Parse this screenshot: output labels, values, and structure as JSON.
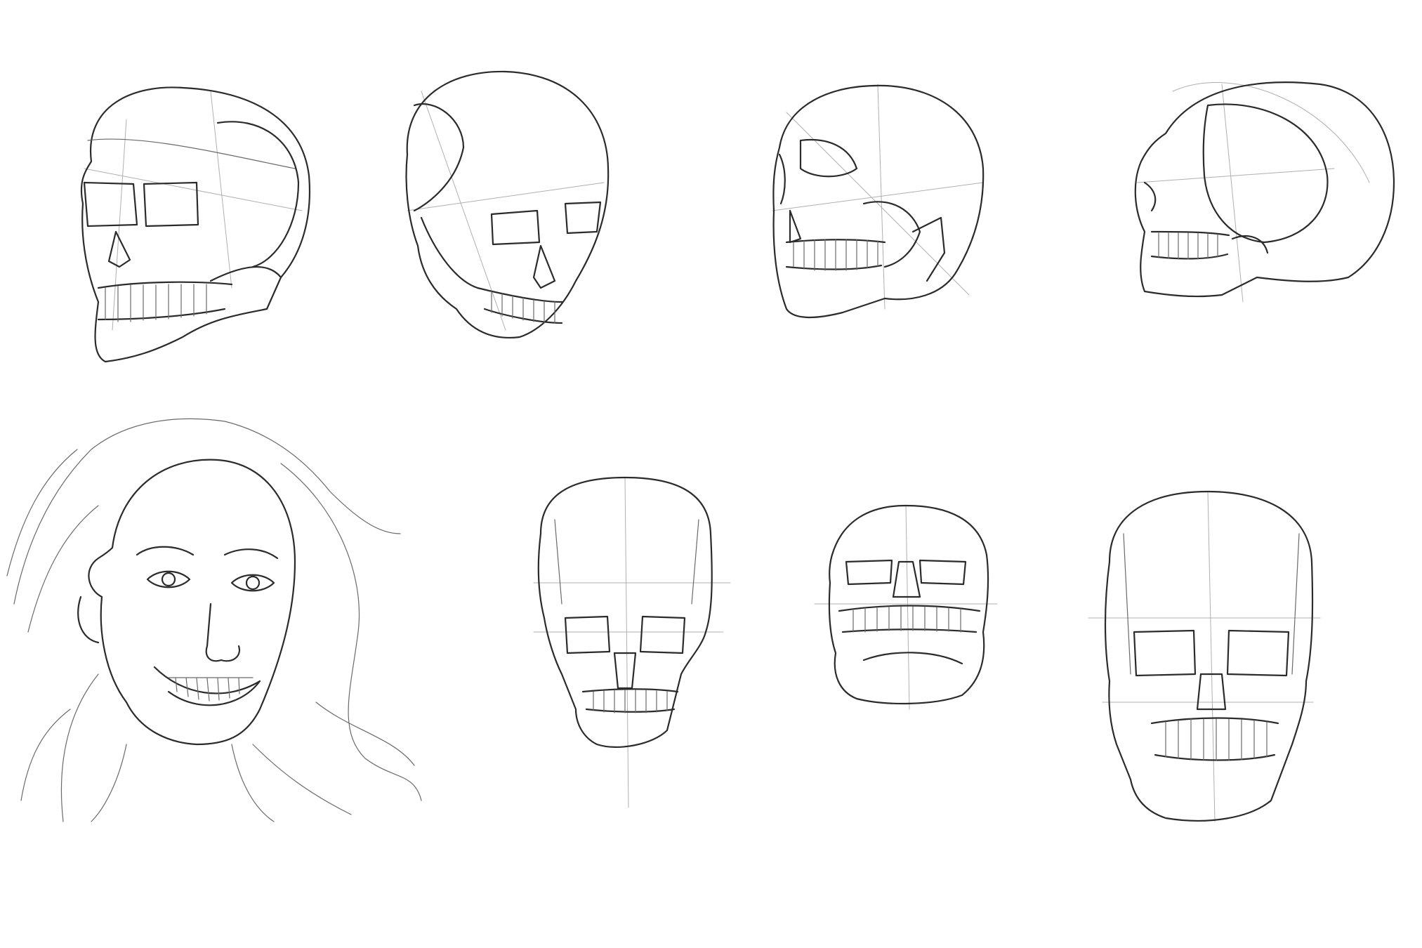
{
  "canvas": {
    "background": "#ffffff",
    "stroke_dark": "#2b2b2b",
    "stroke_mid": "#6a6a6a",
    "stroke_light": "#b0b0b0"
  },
  "drawings": [
    {
      "id": "skull-three-quarter-left"
    },
    {
      "id": "skull-tilted-down"
    },
    {
      "id": "skull-three-quarter-right"
    },
    {
      "id": "skull-profile"
    },
    {
      "id": "woman-portrait-smiling"
    },
    {
      "id": "skull-front-narrow"
    },
    {
      "id": "skull-from-below"
    },
    {
      "id": "skull-front-large"
    }
  ]
}
